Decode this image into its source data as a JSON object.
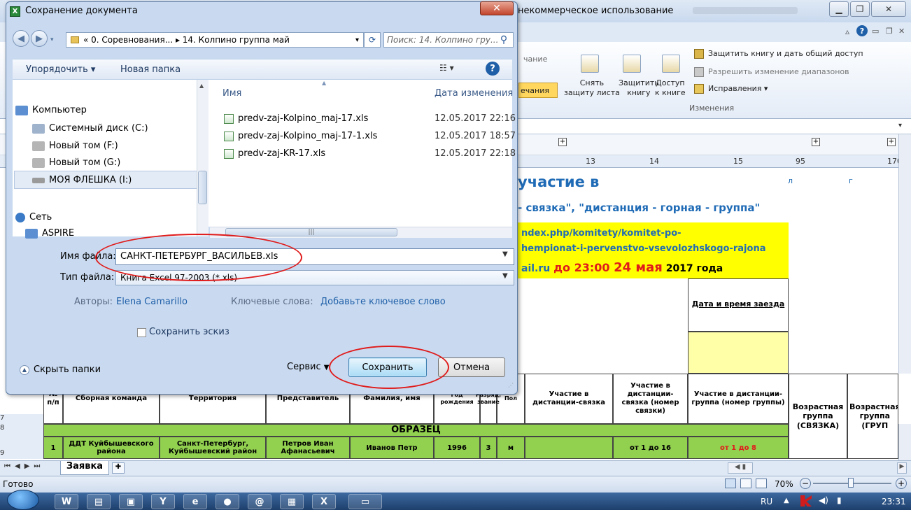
{
  "excel": {
    "window_title": "некоммерческое использование",
    "ribbon": {
      "partial_label_1": "чание",
      "partial_label_2": "ечания",
      "unprotect_sheet": "Снять\nзащиту листа",
      "protect_book": "Защитить\nкнигу",
      "share_book_access": "Доступ\nк книге",
      "protect_share": "Защитить книгу и дать общий доступ",
      "allow_ranges": "Разрешить изменение диапазонов",
      "track_changes": "Исправления",
      "group_changes": "Изменения"
    },
    "col_numbers": [
      "13",
      "14",
      "15",
      "95",
      "170"
    ],
    "sheet": {
      "title": "участие в",
      "subtitle": "- связка\", \"дистанция - горная - группа\"",
      "link1": "ndex.php/komitety/komitet-po-",
      "link2": "hempionat-i-pervenstvo-vsevolozhskogo-rajona",
      "deadline_a": "ail.ru ",
      "deadline_b": "до 23:00 ",
      "deadline_c": "24 мая",
      "deadline_d": " 2017 года",
      "date_time_label": "Дата и время заезда",
      "row_letters": [
        "л",
        "г"
      ],
      "headers": {
        "num": "№ п/п",
        "team": "Сборная команда",
        "territory": "Территория",
        "representative": "Представитель",
        "name": "Фамилия, имя",
        "birth": "Год рождения",
        "rank": "Разряд, звание",
        "sex": "Пол",
        "dist_link": "Участие в дистанции-связка",
        "dist_link_num": "Участие в дистанции-связка (номер связки)",
        "dist_group_num": "Участие в дистанции-группа (номер группы)",
        "age_link": "Возрастная группа (СВЯЗКА)",
        "age_group": "Возрастная группа (ГРУП"
      },
      "sample_label": "ОБРАЗЕЦ",
      "sample_row": {
        "num": "1",
        "team": "ДДТ Куйбышевского района",
        "territory": "Санкт-Петербург, Куйбышевский район",
        "representative": "Петров Иван Афанасьевич",
        "name": "Иванов Петр",
        "birth": "1996",
        "rank": "3",
        "sex": "м",
        "link_num": "от 1 до 16",
        "group_num": "от 1 до 8"
      },
      "row_numbers": [
        "7",
        "8",
        "9"
      ]
    },
    "sheet_tab": "Заявка",
    "status": "Готово",
    "zoom": "70%"
  },
  "dialog": {
    "title": "Сохранение документа",
    "breadcrumb": "« 0. Соревнования... ▸ 14. Колпино группа май",
    "search_placeholder": "Поиск: 14. Колпино гру...",
    "organize": "Упорядочить ▾",
    "new_folder": "Новая папка",
    "nav_items": [
      "Компьютер",
      "Системный диск (C:)",
      "Новый том (F:)",
      "Новый том (G:)",
      "МОЯ ФЛЕШКА (I:)",
      "Сеть",
      "ASPIRE"
    ],
    "col_name": "Имя",
    "col_date": "Дата изменения",
    "files": [
      {
        "name": "predv-zaj-Kolpino_maj-17.xls",
        "date": "12.05.2017 22:16"
      },
      {
        "name": "predv-zaj-Kolpino_maj-17-1.xls",
        "date": "12.05.2017 18:57"
      },
      {
        "name": "predv-zaj-KR-17.xls",
        "date": "12.05.2017 22:18"
      }
    ],
    "filename_label": "Имя файла:",
    "filename_value": "САНКТ-ПЕТЕРБУРГ_ВАСИЛЬЕВ.xls",
    "filetype_label": "Тип файла:",
    "filetype_value": "Книга Excel 97-2003 (*.xls)",
    "authors_label": "Авторы:",
    "authors_value": "Elena Camarillo",
    "keywords_label": "Ключевые слова:",
    "keywords_value": "Добавьте ключевое слово",
    "save_thumbnail": "Сохранить эскиз",
    "hide_folders": "Скрыть папки",
    "service": "Сервис",
    "save": "Сохранить",
    "cancel": "Отмена"
  },
  "taskbar": {
    "lang": "RU",
    "clock": "23:31"
  }
}
